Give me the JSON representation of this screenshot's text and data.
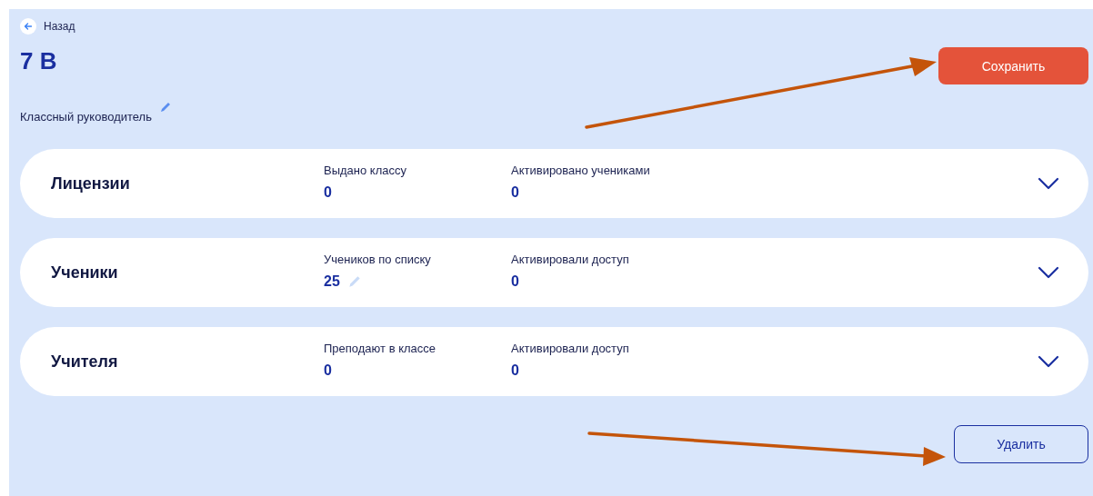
{
  "back": {
    "label": "Назад"
  },
  "title": "7 В",
  "save_button": "Сохранить",
  "teacher_label": "Классный руководитель",
  "sections": [
    {
      "title": "Лицензии",
      "expanded": false,
      "stats": [
        {
          "label": "Выдано классу",
          "value": "0",
          "editable": false
        },
        {
          "label": "Активировано учениками",
          "value": "0",
          "editable": false
        }
      ]
    },
    {
      "title": "Ученики",
      "expanded": false,
      "stats": [
        {
          "label": "Учеников по списку",
          "value": "25",
          "editable": true
        },
        {
          "label": "Активировали доступ",
          "value": "0",
          "editable": false
        }
      ]
    },
    {
      "title": "Учителя",
      "expanded": false,
      "stats": [
        {
          "label": "Преподают в классе",
          "value": "0",
          "editable": false
        },
        {
          "label": "Активировали доступ",
          "value": "0",
          "editable": false
        }
      ]
    }
  ],
  "delete_button": "Удалить"
}
